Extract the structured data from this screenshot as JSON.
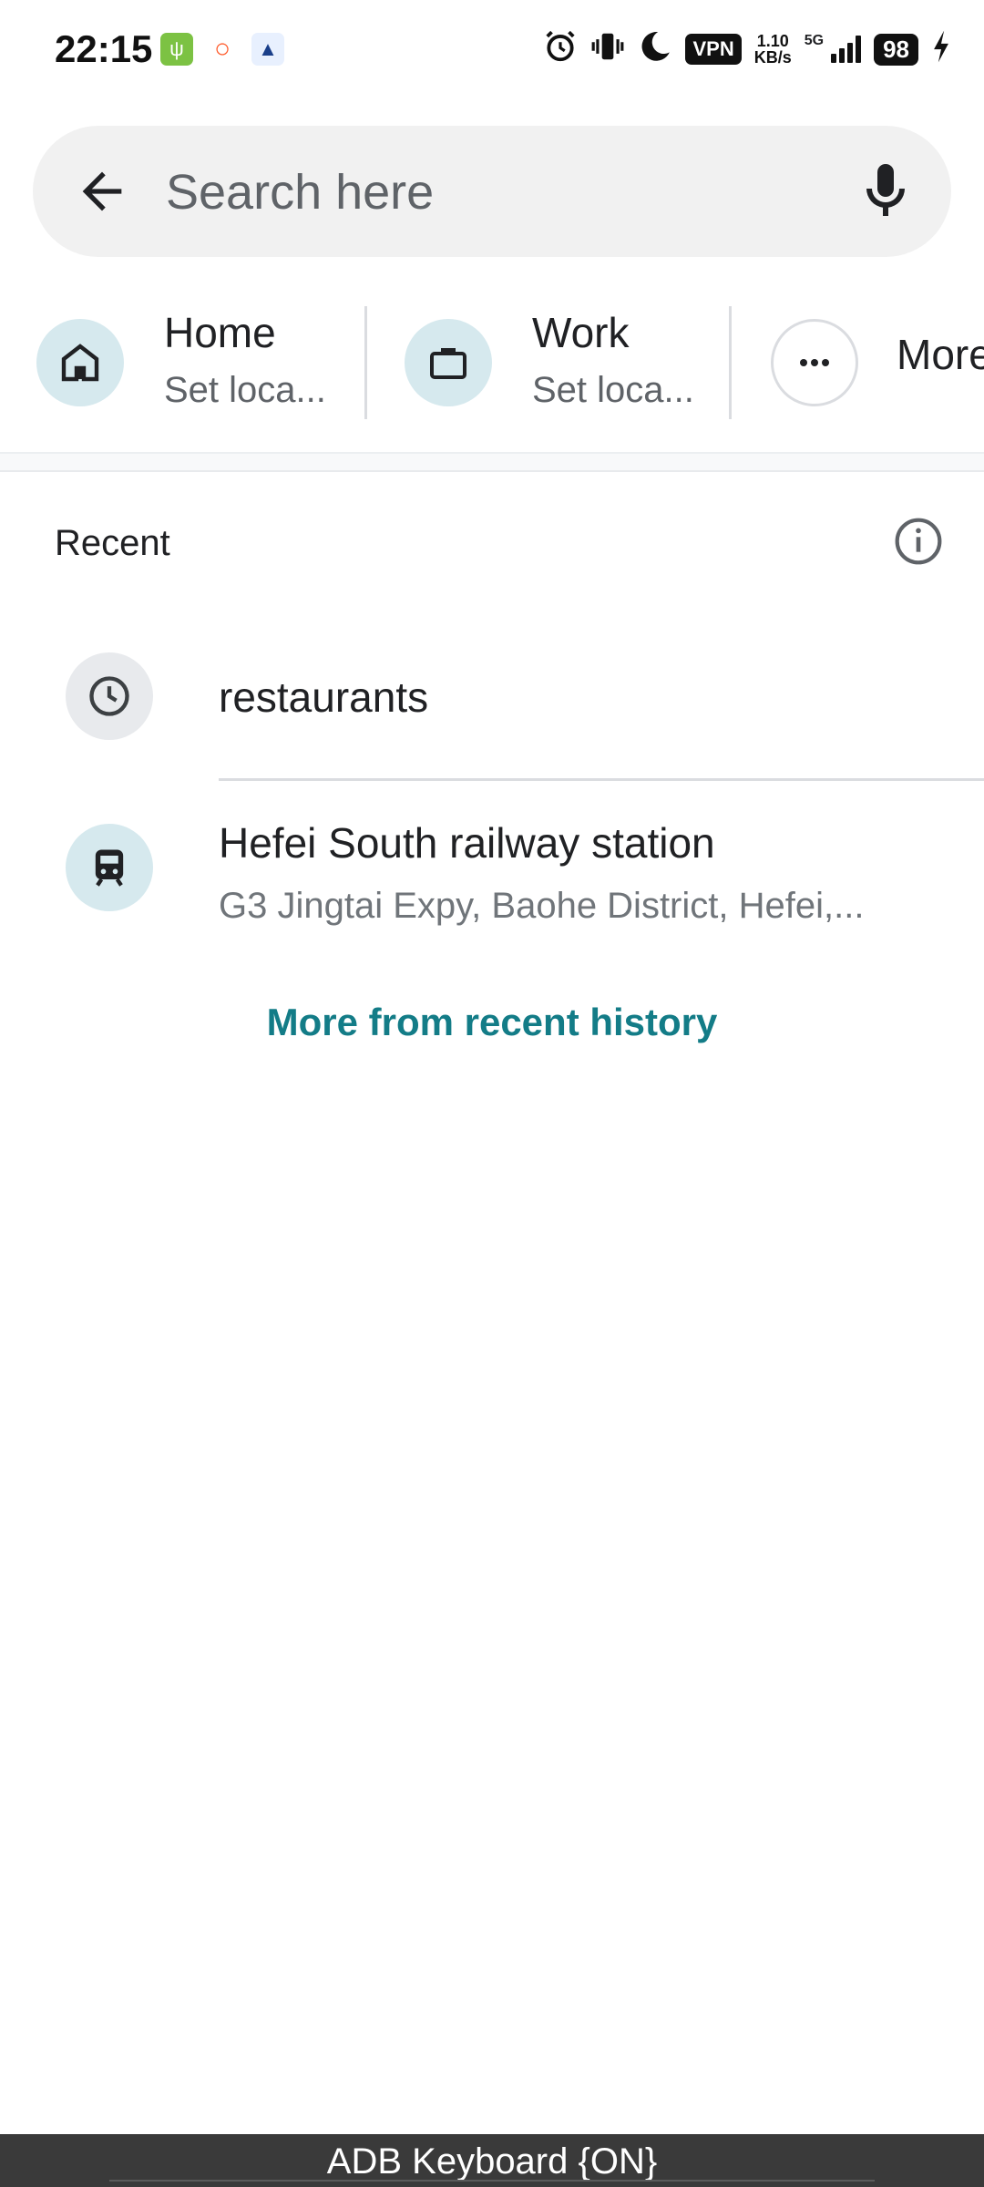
{
  "status_bar": {
    "time": "22:15",
    "vpn_label": "VPN",
    "net_speed_value": "1.10",
    "net_speed_unit": "KB/s",
    "network_type": "5G",
    "battery_level": "98",
    "icons": [
      "usb-debug-icon",
      "orange-circle-app-icon",
      "cat-app-icon",
      "alarm-icon",
      "vibrate-icon",
      "do-not-disturb-moon-icon",
      "vpn-icon",
      "signal-icon",
      "battery-icon",
      "charging-bolt-icon"
    ]
  },
  "search": {
    "placeholder": "Search here"
  },
  "shortcuts": [
    {
      "title": "Home",
      "subtitle": "Set loca...",
      "icon": "home-icon"
    },
    {
      "title": "Work",
      "subtitle": "Set loca...",
      "icon": "briefcase-icon"
    },
    {
      "title": "More",
      "icon": "more-dots-icon"
    }
  ],
  "recent": {
    "title": "Recent",
    "items": [
      {
        "title": "restaurants",
        "icon": "history-clock-icon"
      },
      {
        "title": "Hefei South railway station",
        "subtitle": "G3 Jingtai Expy, Baohe District, Hefei,...",
        "icon": "train-icon"
      }
    ],
    "more_link": "More from recent history"
  },
  "footer": {
    "adb_label": "ADB Keyboard {ON}"
  },
  "colors": {
    "accent_teal": "#137c87",
    "chip_teal_bg": "#d6e9ee",
    "search_bg": "#f1f1f1"
  }
}
